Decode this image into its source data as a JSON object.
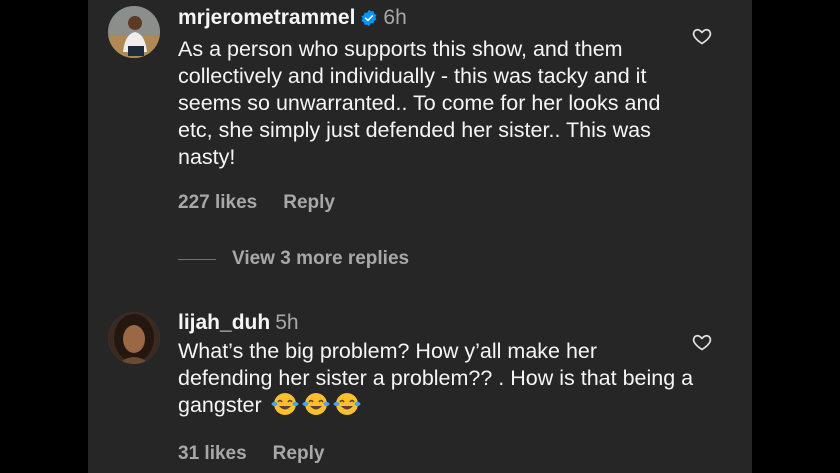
{
  "comments": [
    {
      "username": "mrjerometrammel",
      "verified": true,
      "time": "6h",
      "text": "As a person who supports this show, and them collectively and individually - this was tacky and it seems so unwarranted.. To come for her looks and etc, she simply just defended her sister.. This was nasty!",
      "likes": "227 likes",
      "reply_label": "Reply"
    },
    {
      "username": "lijah_duh",
      "verified": false,
      "time": "5h",
      "text": "What’s the big problem? How y’all make her defending her sister a problem?? . How is that being a gangster",
      "emojis": [
        "face-with-tears-of-joy",
        "face-with-tears-of-joy",
        "face-with-tears-of-joy"
      ],
      "likes": "31 likes",
      "reply_label": "Reply"
    }
  ],
  "view_more_replies": "View 3 more replies",
  "colors": {
    "background": "#262626",
    "text": "#f5f5f5",
    "secondary": "#a8a8a8",
    "verified": "#0095f6"
  }
}
